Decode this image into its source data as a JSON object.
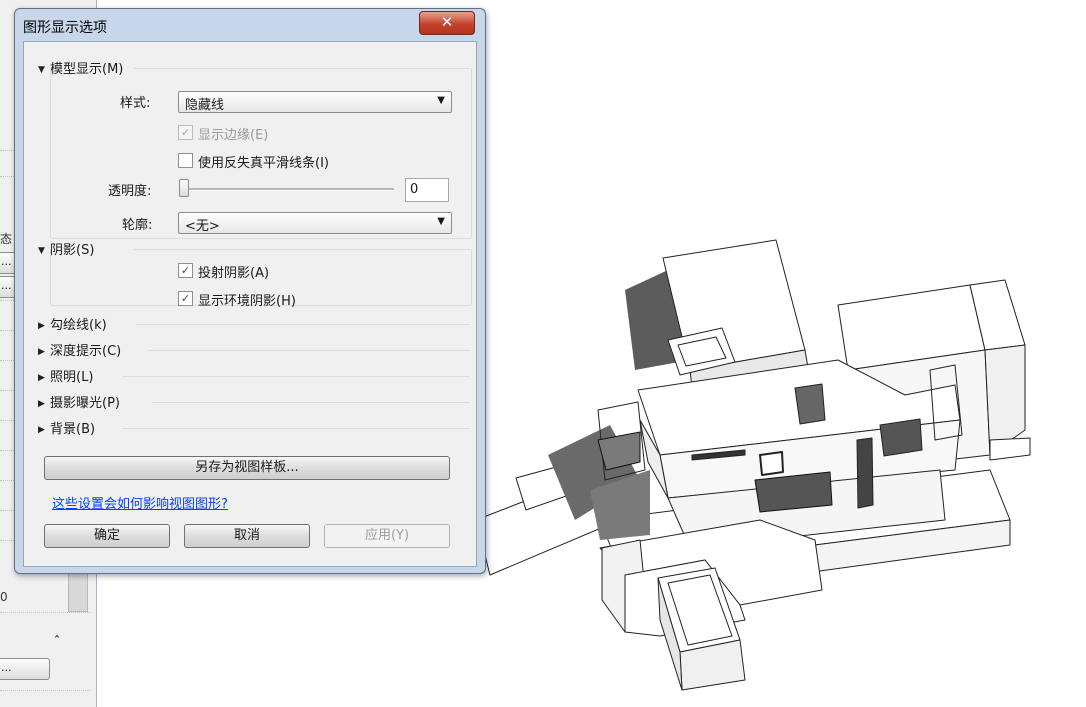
{
  "background_panel": {
    "fragments": [
      "态",
      "...",
      "...",
      "0",
      "..."
    ],
    "collapse_glyph": "ˆ"
  },
  "dialog": {
    "title": "图形显示选项",
    "close_glyph": "✕",
    "model_display": {
      "header": "模型显示(M)",
      "style_label": "样式:",
      "style_value": "隐藏线",
      "show_edges": {
        "label": "显示边缘(E)",
        "checked": true,
        "enabled": false
      },
      "antialias": {
        "label": "使用反失真平滑线条(I)",
        "checked": false,
        "enabled": true
      },
      "transparency_label": "透明度:",
      "transparency_value": "0",
      "silhouette_label": "轮廓:",
      "silhouette_value": "<无>"
    },
    "shadows": {
      "header": "阴影(S)",
      "cast_shadows": {
        "label": "投射阴影(A)",
        "checked": true
      },
      "ambient_shadows": {
        "label": "显示环境阴影(H)",
        "checked": true
      }
    },
    "collapsed_sections": [
      "勾绘线(k)",
      "深度提示(C)",
      "照明(L)",
      "摄影曝光(P)",
      "背景(B)"
    ],
    "save_template_button": "另存为视图样板...",
    "help_link": "这些设置会如何影响视图图形?",
    "ok_button": "确定",
    "cancel_button": "取消",
    "apply_button": "应用(Y)"
  }
}
